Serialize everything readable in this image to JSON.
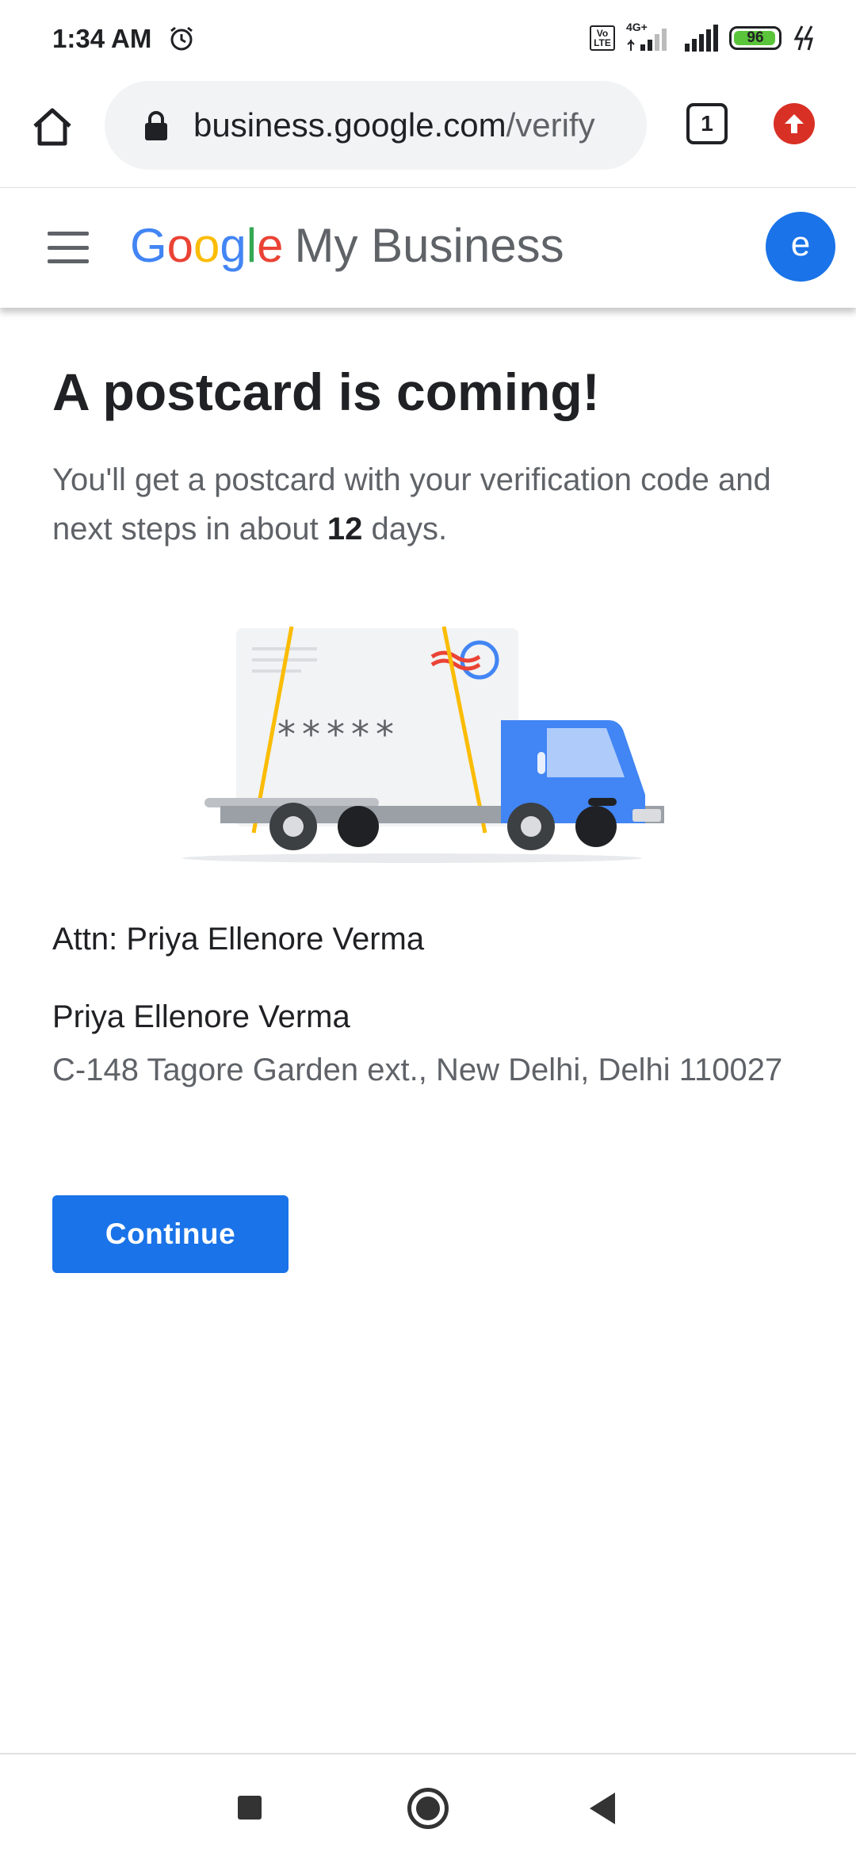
{
  "status_bar": {
    "time": "1:34 AM",
    "network": "4G+",
    "volte_top": "Vo",
    "volte_bottom": "LTE",
    "battery": "96",
    "icons": [
      "alarm-icon",
      "volte-icon",
      "signal-icon",
      "signal-icon",
      "battery-icon",
      "charging-icon"
    ]
  },
  "browser": {
    "url_domain": "business.google.com",
    "url_path": "/verify",
    "tab_count": "1",
    "icons": [
      "home-icon",
      "lock-icon",
      "tab-switcher-icon",
      "update-icon"
    ]
  },
  "header": {
    "brand_letters": [
      "G",
      "o",
      "o",
      "g",
      "l",
      "e"
    ],
    "brand_product": "My Business",
    "avatar_initial": "e",
    "icons": [
      "menu-icon"
    ]
  },
  "main": {
    "title": "A postcard is coming!",
    "desc_before": "You'll get a postcard with your verification code and next steps in about ",
    "desc_days": "12",
    "desc_after": " days.",
    "illustration_code": "*****",
    "attn": "Attn: Priya Ellenore Verma",
    "name": "Priya Ellenore Verma",
    "address": "C-148 Tagore Garden ext., New Delhi, Delhi 110027",
    "continue_label": "Continue"
  },
  "colors": {
    "accent": "#1a73e8",
    "google_blue": "#4285f4",
    "google_red": "#ea4335",
    "google_yellow": "#fbbc05",
    "google_green": "#34a853",
    "battery_fill": "#5ac43a"
  },
  "battery_level": 0.96,
  "nav": {
    "icons": [
      "recents-icon",
      "home-circle-icon",
      "back-icon"
    ]
  }
}
